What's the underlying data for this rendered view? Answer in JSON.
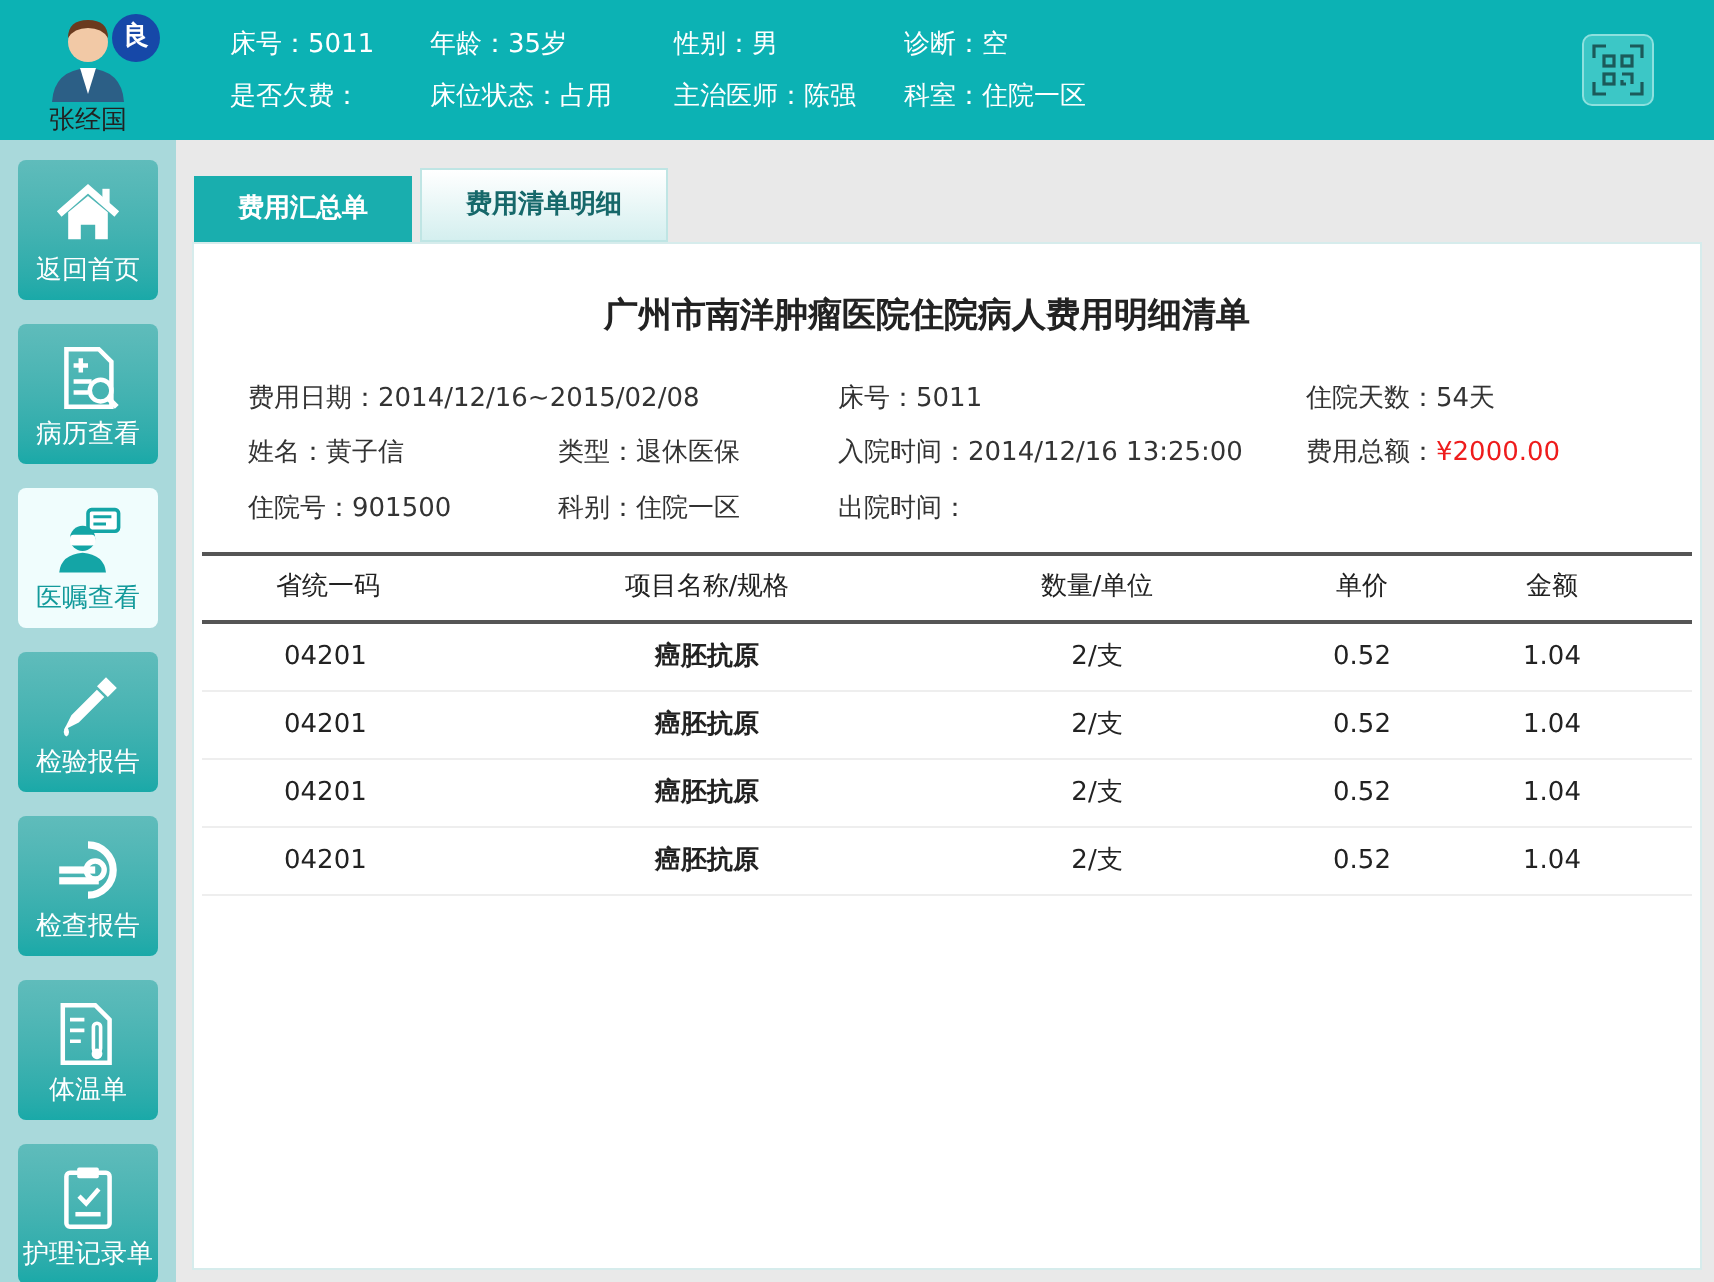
{
  "patient": {
    "name": "张经国",
    "badge": "良"
  },
  "header_fields": [
    [
      {
        "text": "床号：5011"
      },
      {
        "text": "年龄：35岁"
      },
      {
        "text": "性别：男"
      },
      {
        "text": "诊断：空"
      }
    ],
    [
      {
        "text": "是否欠费："
      },
      {
        "text": "床位状态：占用"
      },
      {
        "text": "主治医师：陈强"
      },
      {
        "text": "科室：住院一区"
      }
    ]
  ],
  "sidebar": {
    "items": [
      {
        "label": "返回首页",
        "selected": false
      },
      {
        "label": "病历查看",
        "selected": false
      },
      {
        "label": "医嘱查看",
        "selected": true
      },
      {
        "label": "检验报告",
        "selected": false
      },
      {
        "label": "检查报告",
        "selected": false
      },
      {
        "label": "体温单",
        "selected": false
      },
      {
        "label": "护理记录单",
        "selected": false
      }
    ]
  },
  "tabs": [
    {
      "label": "费用汇总单",
      "selected": true
    },
    {
      "label": "费用清单明细",
      "selected": false
    }
  ],
  "document": {
    "title": "广州市南洋肿瘤医院住院病人费用明细清单",
    "info_rows": [
      [
        {
          "label": "费用日期：",
          "value": "2014/12/16~2015/02/08"
        },
        {
          "label": "床号：",
          "value": "5011"
        },
        {
          "label": "住院天数：",
          "value": "54天"
        }
      ],
      [
        {
          "label": "姓名：",
          "value": "黄子信"
        },
        {
          "label": "类型：",
          "value": "退休医保"
        },
        {
          "label": "入院时间：",
          "value": "2014/12/16  13:25:00"
        },
        {
          "label": "费用总额：",
          "value": "¥2000.00",
          "kind": "amount"
        }
      ],
      [
        {
          "label": "住院号：",
          "value": "901500"
        },
        {
          "label": "科别：",
          "value": "住院一区"
        },
        {
          "label": "出院时间："
        }
      ]
    ],
    "table": {
      "columns": [
        "省统一码",
        "项目名称/规格",
        "数量/单位",
        "单价",
        "金额"
      ],
      "rows": [
        [
          "04201",
          "癌胚抗原",
          "2/支",
          "0.52",
          "1.04"
        ],
        [
          "04201",
          "癌胚抗原",
          "2/支",
          "0.52",
          "1.04"
        ],
        [
          "04201",
          "癌胚抗原",
          "2/支",
          "0.52",
          "1.04"
        ],
        [
          "04201",
          "癌胚抗原",
          "2/支",
          "0.52",
          "1.04"
        ]
      ]
    }
  }
}
